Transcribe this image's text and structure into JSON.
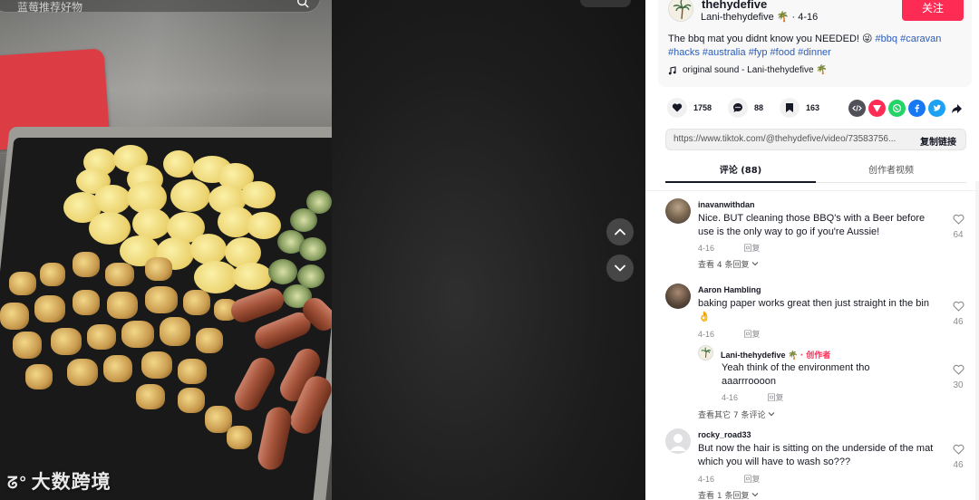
{
  "video": {
    "search_text": "蓝莓推荐好物",
    "watermark": "大数跨境"
  },
  "author": {
    "username": "thehydefive",
    "nickname": "Lani-thehydefive 🌴",
    "date": "4-16",
    "follow_label": "关注"
  },
  "description": {
    "text": "The bbq mat you didnt know you NEEDED! 😜",
    "hashtags": [
      "#bbq",
      "#caravan",
      "#hacks",
      "#australia",
      "#fyp",
      "#food",
      "#dinner"
    ]
  },
  "sound": "original sound - Lani-thehydefive 🌴",
  "stats": {
    "likes": "1758",
    "comments": "88",
    "saves": "163"
  },
  "share": {
    "icons": [
      "embed-icon",
      "send-icon",
      "whatsapp-icon",
      "facebook-icon",
      "twitter-icon",
      "share-arrow-icon"
    ],
    "colors": {
      "embed": "#4f5058",
      "send": "#fe2c55",
      "whatsapp": "#25d366",
      "facebook": "#1877f2",
      "twitter": "#1da1f2"
    }
  },
  "link": {
    "url": "https://www.tiktok.com/@thehydefive/video/73583756...",
    "copy_label": "复制链接"
  },
  "tabs": [
    {
      "label": "评论 (88)",
      "active": true
    },
    {
      "label": "创作者视频",
      "active": false
    }
  ],
  "comments": [
    {
      "username": "inavanwithdan",
      "text": "Nice. BUT cleaning those BBQ's with a Beer before use is the only way to go if you're Aussie!",
      "date": "4-16",
      "reply_label": "回复",
      "likes": "64",
      "more": "查看 4 条回复"
    },
    {
      "username": "Aaron Hambling",
      "text": "baking paper works great then just straight in the bin 👌",
      "date": "4-16",
      "reply_label": "回复",
      "likes": "46",
      "reply": {
        "username": "Lani-thehydefive 🌴",
        "creator_badge": "· 创作者",
        "text": "Yeah think of the environment tho aaarrroooon",
        "date": "4-16",
        "reply_label": "回复",
        "likes": "30"
      },
      "more": "查看其它 7 条评论"
    },
    {
      "username": "rocky_road33",
      "text": "But now the hair is sitting on the underside of the mat which you will have to wash so???",
      "date": "4-16",
      "reply_label": "回复",
      "likes": "46",
      "more": "查看 1 条回复"
    }
  ],
  "colors": {
    "accent": "#fe2c55",
    "hashtag": "#2b5db9",
    "text": "#161823",
    "muted": "#8a8b91"
  }
}
